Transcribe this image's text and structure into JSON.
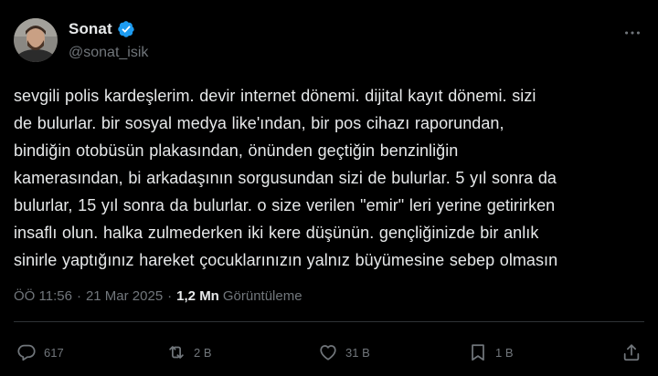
{
  "author": {
    "display_name": "Sonat",
    "handle": "@sonat_isik",
    "verified": true
  },
  "tweet": {
    "text": "sevgili polis kardeşlerim. devir internet  dönemi. dijital kayıt dönemi. sizi\nde bulurlar. bir sosyal medya like'ından, bir pos cihazı raporundan,\nbindiğin otobüsün plakasından, önünden geçtiğin benzinliğin\nkamerasından, bi arkadaşının sorgusundan sizi de bulurlar. 5 yıl sonra da\nbulurlar, 15 yıl sonra da bulurlar. o size verilen \"emir\" leri yerine getirirken\ninsaflı olun. halka zulmederken iki kere düşünün. gençliğinizde bir anlık\nsinirle yaptığınız hareket çocuklarınızın yalnız büyümesine sebep olmasın"
  },
  "meta": {
    "time": "ÖÖ 11:56",
    "separator": "·",
    "date": "21 Mar 2025",
    "views_count": "1,2 Mn",
    "views_label": "Görüntüleme"
  },
  "actions": {
    "replies": "617",
    "reposts": "2 B",
    "likes": "31 B",
    "bookmarks": "1 B"
  },
  "icons": {
    "more": "more-icon",
    "verified": "verified-badge-icon",
    "reply": "reply-icon",
    "repost": "repost-icon",
    "like": "heart-icon",
    "bookmark": "bookmark-icon",
    "share": "share-icon"
  },
  "colors": {
    "background": "#000000",
    "text_primary": "#e7e9ea",
    "text_secondary": "#71767b",
    "verified_blue": "#1d9bf0",
    "divider": "#2f3336"
  }
}
